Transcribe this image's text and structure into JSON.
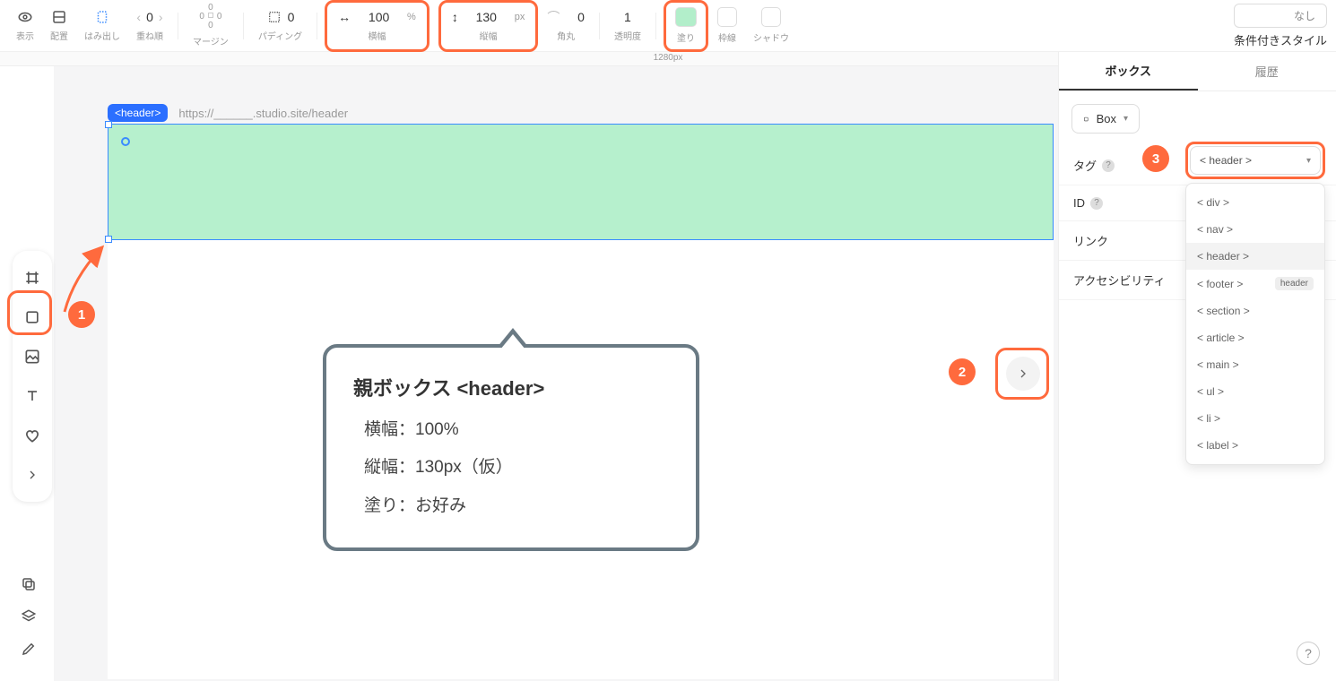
{
  "toolbar": {
    "display_label": "表示",
    "layout_label": "配置",
    "overflow_label": "はみ出し",
    "zindex_label": "重ね順",
    "zindex_value": "0",
    "margin_label": "マージン",
    "margin_top": "0",
    "margin_right": "0",
    "margin_bottom": "0",
    "margin_left": "0",
    "padding_label": "パディング",
    "padding_value": "0",
    "width_label": "横幅",
    "width_value": "100",
    "width_unit": "%",
    "height_label": "縦幅",
    "height_value": "130",
    "height_unit": "px",
    "radius_label": "角丸",
    "radius_value": "0",
    "opacity_label": "透明度",
    "opacity_value": "1",
    "fill_label": "塗り",
    "border_label": "枠線",
    "shadow_label": "シャドウ",
    "none_btn": "なし",
    "conditional_style": "条件付きスタイル"
  },
  "ruler": {
    "width_readout": "1280px"
  },
  "canvas": {
    "tag_pill": "<header>",
    "url": "https://______.studio.site/header"
  },
  "bubble": {
    "title": "親ボックス <header>",
    "line1": "横幅：100%",
    "line2": "縦幅：130px（仮）",
    "line3": "塗り：お好み"
  },
  "steps": {
    "s1": "1",
    "s2": "2",
    "s3": "3"
  },
  "panel": {
    "tab_box": "ボックス",
    "tab_history": "履歴",
    "box_chip": "Box",
    "prop_tag": "タグ",
    "prop_id": "ID",
    "prop_link": "リンク",
    "prop_a11y": "アクセシビリティ",
    "tag_selected": "< header >",
    "tag_options": [
      "< div >",
      "< nav >",
      "< header >",
      "< footer >",
      "< section >",
      "< article >",
      "< main >",
      "< ul >",
      "< li >",
      "< label >"
    ],
    "footer_hint": "header"
  },
  "help": "?"
}
